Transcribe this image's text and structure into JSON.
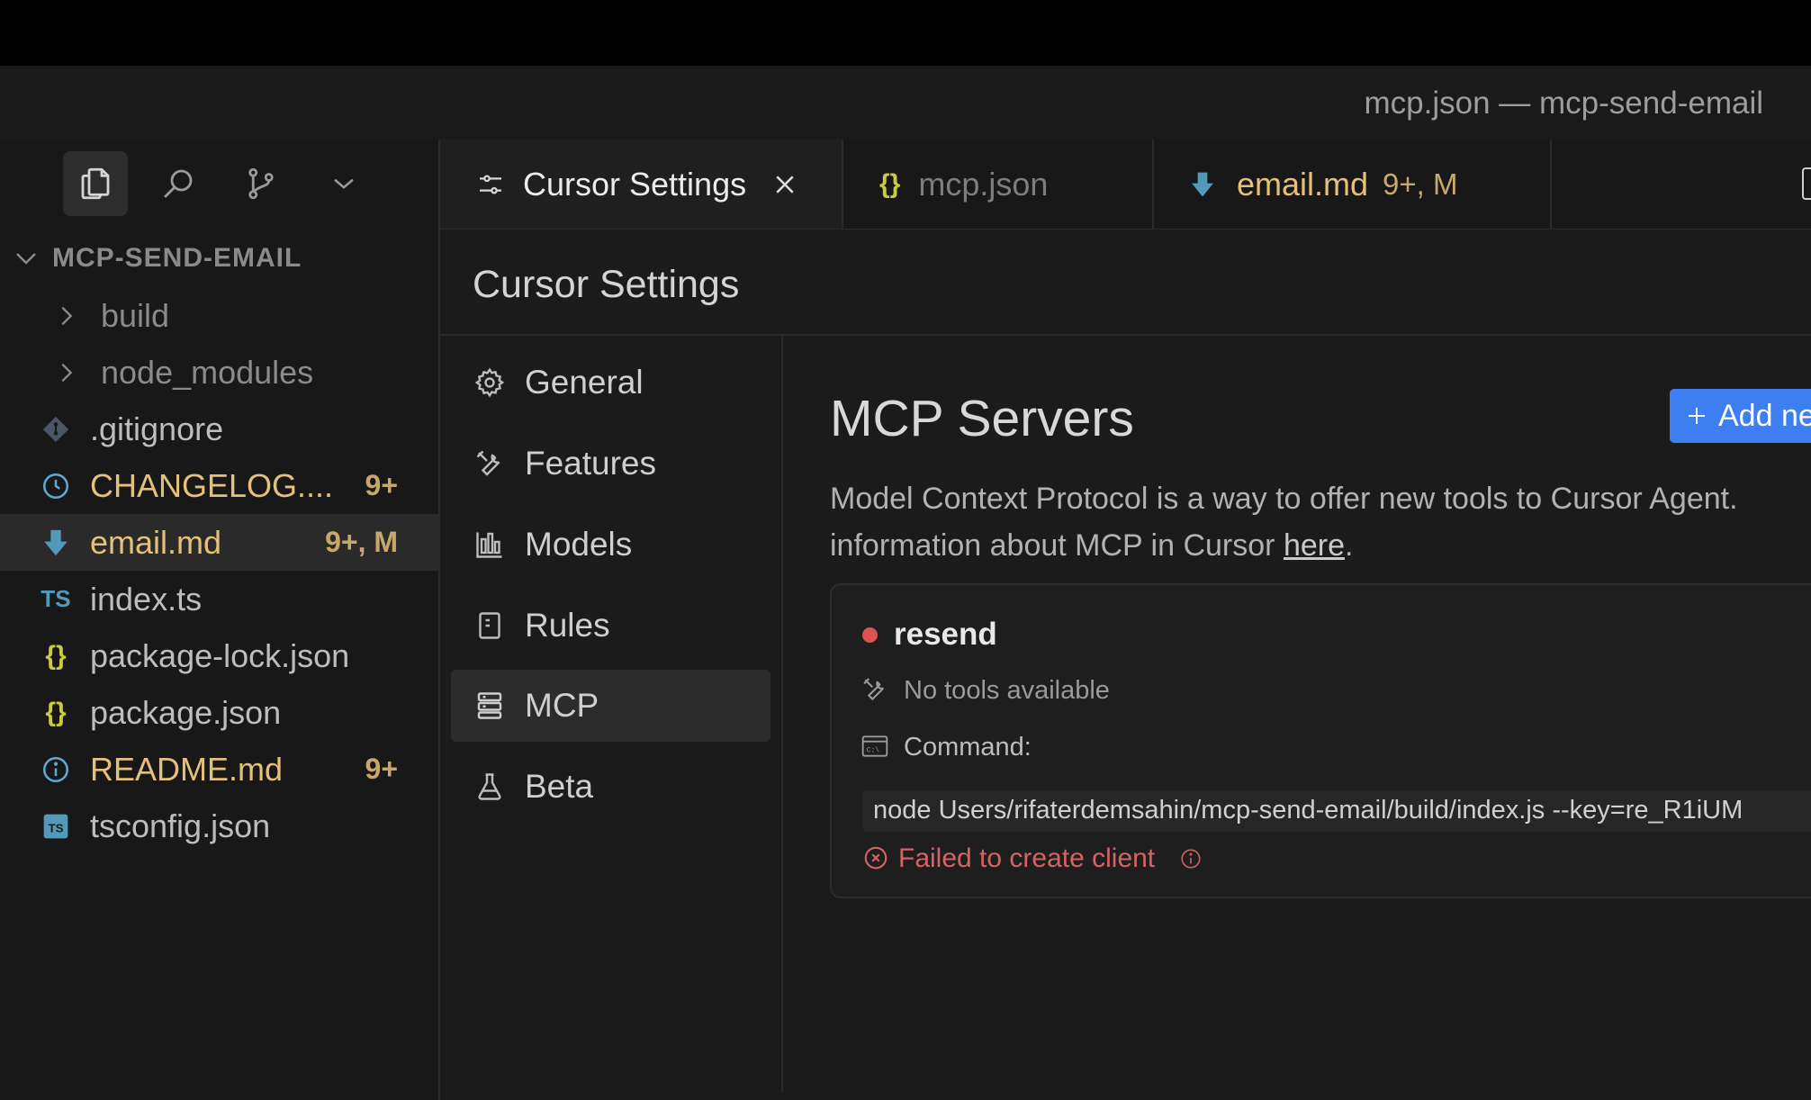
{
  "window": {
    "title": "mcp.json — mcp-send-email"
  },
  "explorer": {
    "root_label": "MCP-SEND-EMAIL",
    "items": [
      {
        "name": "build",
        "type": "folder",
        "icon": "chevron-right-icon",
        "badge": ""
      },
      {
        "name": "node_modules",
        "type": "folder",
        "icon": "chevron-right-icon",
        "badge": ""
      },
      {
        "name": ".gitignore",
        "type": "file",
        "icon": "git-icon",
        "badge": ""
      },
      {
        "name": "CHANGELOG....",
        "type": "file",
        "icon": "clock-icon",
        "badge": "9+"
      },
      {
        "name": "email.md",
        "type": "file",
        "icon": "download-arrow-icon",
        "badge": "9+, M"
      },
      {
        "name": "index.ts",
        "type": "file",
        "icon": "typescript-icon",
        "badge": ""
      },
      {
        "name": "package-lock.json",
        "type": "file",
        "icon": "json-braces-icon",
        "badge": ""
      },
      {
        "name": "package.json",
        "type": "file",
        "icon": "json-braces-icon",
        "badge": ""
      },
      {
        "name": "README.md",
        "type": "file",
        "icon": "info-icon",
        "badge": "9+"
      },
      {
        "name": "tsconfig.json",
        "type": "file",
        "icon": "tsconfig-icon",
        "badge": ""
      }
    ]
  },
  "tabs": [
    {
      "label": "Cursor Settings",
      "icon": "sliders-icon",
      "active": true
    },
    {
      "label": "mcp.json",
      "icon": "json-braces-icon",
      "active": false
    },
    {
      "label": "email.md",
      "badge": "9+, M",
      "icon": "download-arrow-icon",
      "active": false
    }
  ],
  "settings": {
    "title": "Cursor Settings",
    "nav": [
      {
        "label": "General",
        "icon": "gear-icon"
      },
      {
        "label": "Features",
        "icon": "tools-icon"
      },
      {
        "label": "Models",
        "icon": "bar-chart-icon"
      },
      {
        "label": "Rules",
        "icon": "document-icon"
      },
      {
        "label": "MCP",
        "icon": "server-icon",
        "active": true
      },
      {
        "label": "Beta",
        "icon": "flask-icon"
      }
    ]
  },
  "mcp": {
    "heading": "MCP Servers",
    "add_button": "Add ne",
    "description_prefix": "Model Context Protocol is a way to offer new tools to Cursor Agent.",
    "description_line2": "information about MCP in Cursor ",
    "description_link": "here",
    "description_suffix": ".",
    "server": {
      "name": "resend",
      "status_color": "#e05252",
      "tools_text": "No tools available",
      "command_label": "Command:",
      "command": "node Users/rifaterdemsahin/mcp-send-email/build/index.js --key=re_R1iUM",
      "error_text": "Failed to create client"
    }
  }
}
